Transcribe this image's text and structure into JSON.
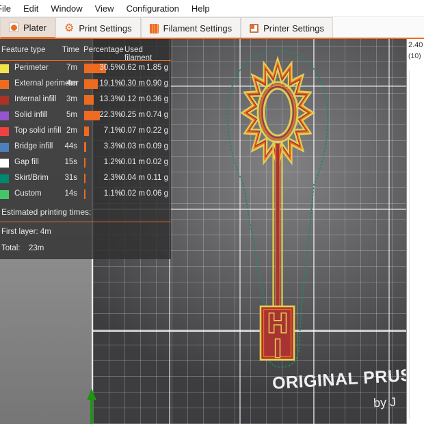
{
  "menu": {
    "items": [
      "File",
      "Edit",
      "Window",
      "View",
      "Configuration",
      "Help"
    ]
  },
  "tabs": [
    {
      "label": "Plater",
      "active": true
    },
    {
      "label": "Print Settings",
      "active": false
    },
    {
      "label": "Filament Settings",
      "active": false
    },
    {
      "label": "Printer Settings",
      "active": false
    }
  ],
  "legend": {
    "headers": {
      "feature": "Feature type",
      "time": "Time",
      "percentage": "Percentage",
      "filament": "Used filament"
    },
    "rows": [
      {
        "label": "Perimeter",
        "color": "#F2E24C",
        "time": "7m",
        "pct": "30.5%",
        "pct_value": 30.5,
        "length": "0.62 m",
        "weight": "1.85 g"
      },
      {
        "label": "External perimeter",
        "color": "#ED6B21",
        "time": "4m",
        "pct": "19.1%",
        "pct_value": 19.1,
        "length": "0.30 m",
        "weight": "0.90 g"
      },
      {
        "label": "Internal infill",
        "color": "#AC3225",
        "time": "3m",
        "pct": "13.3%",
        "pct_value": 13.3,
        "length": "0.12 m",
        "weight": "0.36 g"
      },
      {
        "label": "Solid infill",
        "color": "#9654CC",
        "time": "5m",
        "pct": "22.3%",
        "pct_value": 22.3,
        "length": "0.25 m",
        "weight": "0.74 g"
      },
      {
        "label": "Top solid infill",
        "color": "#F04040",
        "time": "2m",
        "pct": "7.1%",
        "pct_value": 7.1,
        "length": "0.07 m",
        "weight": "0.22 g"
      },
      {
        "label": "Bridge infill",
        "color": "#4D80BA",
        "time": "44s",
        "pct": "3.3%",
        "pct_value": 3.3,
        "length": "0.03 m",
        "weight": "0.09 g"
      },
      {
        "label": "Gap fill",
        "color": "#FFFFFF",
        "time": "15s",
        "pct": "1.2%",
        "pct_value": 1.2,
        "length": "0.01 m",
        "weight": "0.02 g"
      },
      {
        "label": "Skirt/Brim",
        "color": "#00876E",
        "time": "31s",
        "pct": "2.3%",
        "pct_value": 2.3,
        "length": "0.04 m",
        "weight": "0.11 g"
      },
      {
        "label": "Custom",
        "color": "#45C56A",
        "time": "14s",
        "pct": "1.1%",
        "pct_value": 1.1,
        "length": "0.02 m",
        "weight": "0.06 g"
      }
    ],
    "estimated_title": "Estimated printing times:",
    "first_layer_label": "First layer:",
    "first_layer_value": "4m",
    "total_label": "Total:",
    "total_value": "23m"
  },
  "slider": {
    "z_height": "2.40",
    "layer_number": "(10)"
  },
  "bed": {
    "brand_text": "ORIGINAL PRUSA",
    "byline": "by J"
  },
  "model": {
    "letters": [
      "H",
      "I"
    ],
    "colors": {
      "perimeter": "#E2CF52",
      "external_perimeter": "#ED6B21",
      "infill": "#AC3225",
      "fill_red": "#A83333",
      "skirt": "#1D8A62"
    }
  },
  "colors": {
    "accent": "#ED6B21",
    "axis_y_green": "#1F9414",
    "bed_line_bright": "#FFFFFF"
  }
}
